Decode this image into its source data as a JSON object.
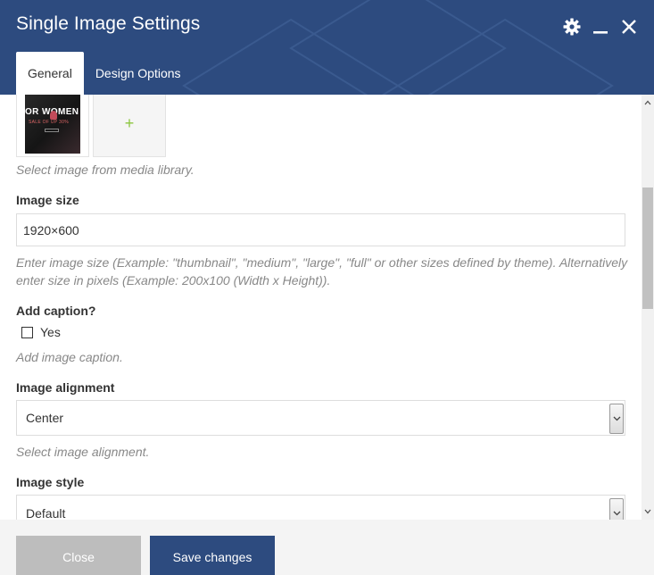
{
  "header": {
    "title": "Single Image Settings",
    "tabs": [
      {
        "label": "General",
        "active": true
      },
      {
        "label": "Design Options",
        "active": false
      }
    ],
    "icons": [
      "gear-icon",
      "minimize-icon",
      "close-icon"
    ]
  },
  "image": {
    "thumb_text": "OR WOMEN",
    "thumb_sub": "SALE OF UP 30%",
    "add_label": "+",
    "hint": "Select image from media library."
  },
  "image_size": {
    "label": "Image size",
    "value": "1920×600",
    "hint_line1": "Enter image size (Example: \"thumbnail\", \"medium\", \"large\", \"full\" or other sizes defined by theme). Alternatively",
    "hint_line2": "enter size in pixels (Example: 200x100 (Width x Height))."
  },
  "caption": {
    "label": "Add caption?",
    "option": "Yes",
    "checked": false,
    "hint": "Add image caption."
  },
  "alignment": {
    "label": "Image alignment",
    "value": "Center",
    "hint": "Select image alignment."
  },
  "style": {
    "label": "Image style",
    "value": "Default"
  },
  "footer": {
    "close_label": "Close",
    "save_label": "Save changes"
  },
  "colors": {
    "brand": "#2d4b7f",
    "plus": "#8cc63f",
    "close_btn": "#bdbdbd"
  }
}
